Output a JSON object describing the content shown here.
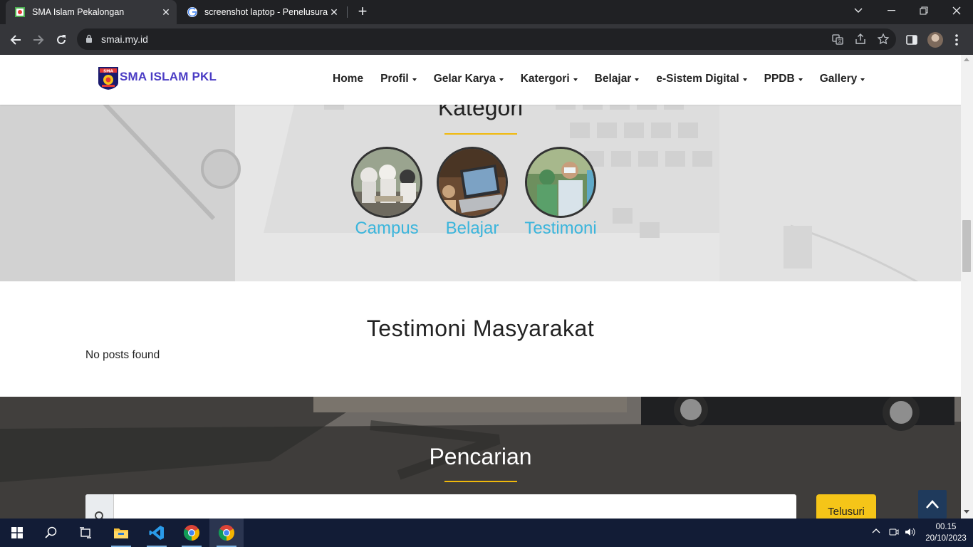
{
  "browser": {
    "tabs": [
      {
        "title": "SMA Islam Pekalongan",
        "active": true
      },
      {
        "title": "screenshot laptop - Penelusuran",
        "active": false
      }
    ],
    "url": "smai.my.id"
  },
  "site": {
    "brand": "SMA ISLAM PKL",
    "logo_text": "SMA",
    "menu": [
      "Home",
      "Profil",
      "Gelar Karya",
      "Katergori",
      "Belajar",
      "e-Sistem Digital",
      "PPDB",
      "Gallery"
    ],
    "menu_has_dropdown": [
      false,
      true,
      true,
      true,
      true,
      true,
      true,
      true
    ]
  },
  "kategori": {
    "heading": "Kategori",
    "items": [
      {
        "label": "Campus"
      },
      {
        "label": "Belajar"
      },
      {
        "label": "Testimoni"
      }
    ],
    "accent": "#f0b90b",
    "label_color": "#3bb5dc"
  },
  "testimoni": {
    "heading": "Testimoni Masyarakat",
    "empty_text": "No posts found"
  },
  "pencarian": {
    "heading": "Pencarian",
    "input_value": "",
    "button_label": "Telusuri"
  },
  "taskbar": {
    "apps": [
      "windows-start",
      "search",
      "task-view",
      "file-explorer",
      "vs-code",
      "chrome",
      "chrome-active"
    ],
    "time": "00.15",
    "date": "20/10/2023"
  }
}
